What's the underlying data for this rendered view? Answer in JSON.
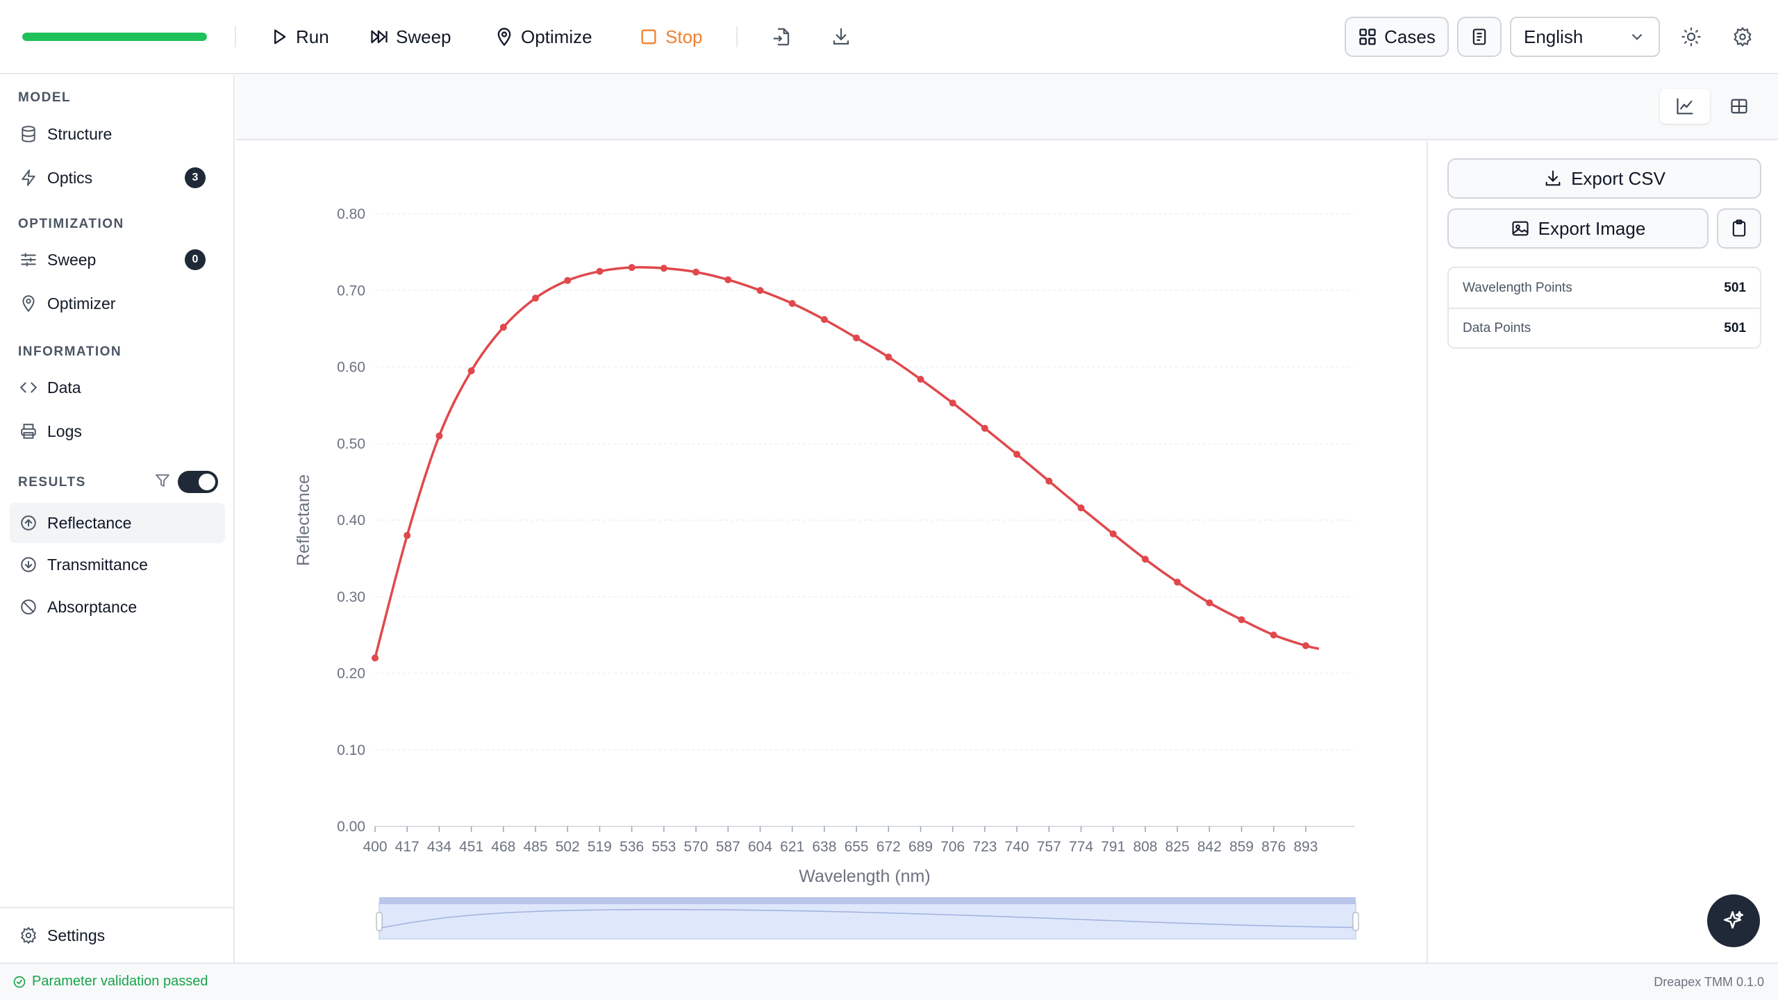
{
  "toolbar": {
    "progress": 1.0,
    "run_label": "Run",
    "sweep_label": "Sweep",
    "optimize_label": "Optimize",
    "stop_label": "Stop",
    "cases_label": "Cases",
    "language": "English"
  },
  "sidebar": {
    "sections": {
      "model": "MODEL",
      "optimization": "OPTIMIZATION",
      "information": "INFORMATION",
      "results": "RESULTS"
    },
    "items": {
      "structure": "Structure",
      "optics": "Optics",
      "optics_badge": "3",
      "sweep": "Sweep",
      "sweep_badge": "0",
      "optimizer": "Optimizer",
      "data": "Data",
      "logs": "Logs",
      "reflectance": "Reflectance",
      "transmittance": "Transmittance",
      "absorptance": "Absorptance"
    },
    "settings": "Settings"
  },
  "panel": {
    "export_csv": "Export CSV",
    "export_image": "Export Image",
    "stats": [
      {
        "label": "Wavelength Points",
        "value": "501"
      },
      {
        "label": "Data Points",
        "value": "501"
      }
    ]
  },
  "status": {
    "message": "Parameter validation passed",
    "version": "Dreapex TMM 0.1.0"
  },
  "colors": {
    "series": "#e0484c",
    "accent": "#1f2937",
    "success": "#16a34a",
    "warning": "#f0812f"
  },
  "chart_data": {
    "type": "line",
    "xlabel": "Wavelength (nm)",
    "ylabel": "Reflectance",
    "x": [
      400,
      417,
      434,
      451,
      468,
      485,
      502,
      519,
      536,
      553,
      570,
      587,
      604,
      621,
      638,
      655,
      672,
      689,
      706,
      723,
      740,
      757,
      774,
      791,
      808,
      825,
      842,
      859,
      876,
      893
    ],
    "y": [
      0.22,
      0.38,
      0.51,
      0.595,
      0.652,
      0.69,
      0.713,
      0.725,
      0.73,
      0.729,
      0.724,
      0.714,
      0.7,
      0.683,
      0.662,
      0.638,
      0.613,
      0.584,
      0.553,
      0.52,
      0.486,
      0.451,
      0.416,
      0.382,
      0.349,
      0.319,
      0.292,
      0.27,
      0.25,
      0.236
    ],
    "x_end": 900,
    "y_end": 0.232,
    "xlim": [
      400,
      900
    ],
    "ylim": [
      0,
      0.8
    ],
    "yticks": [
      "0.00",
      "0.10",
      "0.20",
      "0.30",
      "0.40",
      "0.50",
      "0.60",
      "0.70",
      "0.80"
    ],
    "xticks": [
      "400",
      "417",
      "434",
      "451",
      "468",
      "485",
      "502",
      "519",
      "536",
      "553",
      "570",
      "587",
      "604",
      "621",
      "638",
      "655",
      "672",
      "689",
      "706",
      "723",
      "740",
      "757",
      "774",
      "791",
      "808",
      "825",
      "842",
      "859",
      "876",
      "893"
    ],
    "grid": true
  }
}
